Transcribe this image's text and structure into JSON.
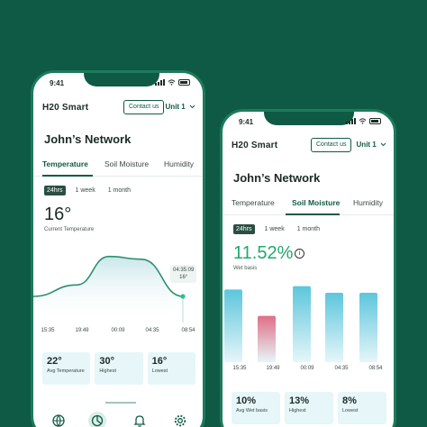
{
  "phone1": {
    "time": "9:41",
    "brand": "H20 Smart",
    "contact_label": "Contact us",
    "unit_label": "Unit 1",
    "title": "John’s Network",
    "tabs": [
      "Temperature",
      "Soil Moisture",
      "Humidity"
    ],
    "active_tab": "Temperature",
    "ranges": [
      "24hrs",
      "1 week",
      "1 month"
    ],
    "active_range": "24hrs",
    "value": "16°",
    "value_label": "Current Temperature",
    "tooltip": {
      "time": "04:35:09",
      "value": "16°"
    },
    "stats": [
      {
        "value": "22°",
        "label": "Avg Temperature"
      },
      {
        "value": "30°",
        "label": "Highest"
      },
      {
        "value": "16°",
        "label": "Lowest"
      }
    ],
    "nav_icons": [
      "globe-icon",
      "dashboard-icon",
      "bell-icon",
      "gear-icon"
    ]
  },
  "phone2": {
    "time": "9:41",
    "brand": "H20 Smart",
    "contact_label": "Contact us",
    "unit_label": "Unit 1",
    "title": "John’s Network",
    "tabs": [
      "Temperature",
      "Soil Moisture",
      "Humidity"
    ],
    "active_tab": "Soil Moisture",
    "ranges": [
      "24hrs",
      "1 week",
      "1 month"
    ],
    "active_range": "24hrs",
    "value": "11.52%",
    "info_glyph": "i",
    "value_label": "Wet basis",
    "stats": [
      {
        "value": "10%",
        "label": "Avg Wet basis"
      },
      {
        "value": "13%",
        "label": "Highest"
      },
      {
        "value": "8%",
        "label": "Lowest"
      }
    ]
  },
  "chart_data": [
    {
      "type": "area",
      "title": "",
      "x": [
        "15:35",
        "19:49",
        "00:09",
        "04:35",
        "08:54"
      ],
      "series": [
        {
          "values": [
            16,
            20,
            30,
            29,
            16
          ]
        }
      ],
      "ylim": [
        10,
        34
      ],
      "color": "#2a8f6e"
    },
    {
      "type": "bar",
      "title": "",
      "categories": [
        "15:35",
        "19:49",
        "00:09",
        "04:35",
        "08:54"
      ],
      "values": [
        11,
        7,
        11.5,
        10.5,
        10.5
      ],
      "ylim": [
        0,
        12
      ],
      "highlight_index": 1,
      "color": "#5cc6dd",
      "highlight_color": "#e06f86"
    }
  ]
}
